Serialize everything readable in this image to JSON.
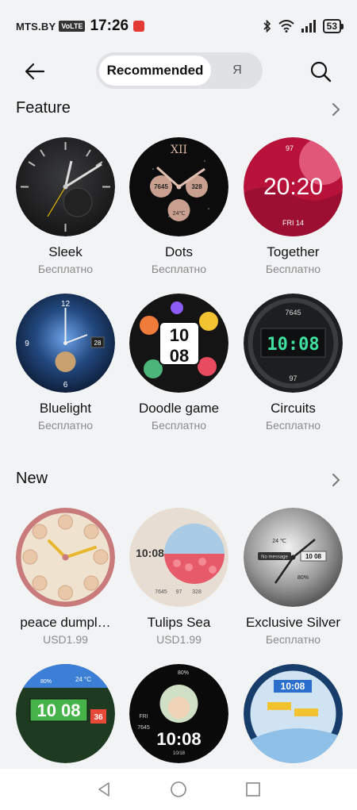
{
  "status": {
    "carrier": "MTS.BY",
    "volte": "VoLTE",
    "time": "17:26",
    "battery": "53"
  },
  "header": {
    "tab_active": "Recommended",
    "tab_other": "Я"
  },
  "sections": {
    "feature": {
      "title": "Feature",
      "items": [
        {
          "name": "Sleek",
          "price": "Бесплатно"
        },
        {
          "name": "Dots",
          "price": "Бесплатно"
        },
        {
          "name": "Together",
          "price": "Бесплатно"
        },
        {
          "name": "Bluelight",
          "price": "Бесплатно"
        },
        {
          "name": "Doodle game",
          "price": "Бесплатно"
        },
        {
          "name": "Circuits",
          "price": "Бесплатно"
        }
      ]
    },
    "new": {
      "title": "New",
      "items": [
        {
          "name": "peace dumpl…",
          "price": "USD1.99"
        },
        {
          "name": "Tulips Sea",
          "price": "USD1.99"
        },
        {
          "name": "Exclusive Silver",
          "price": "Бесплатно"
        }
      ]
    }
  },
  "dial_text": {
    "dots_left": "7645",
    "dots_right": "328",
    "dots_bottom": "24℃",
    "together_hr": "97",
    "together_time": "20:20",
    "together_date": "FRI 14",
    "bluelight_date": "28",
    "doodle_top": "10",
    "doodle_bottom": "08",
    "circuits_top": "7645",
    "circuits_time": "10:08",
    "circuits_bottom": "97",
    "tulips_time": "10:08",
    "tulips_steps": "7645",
    "tulips_a": "97",
    "tulips_b": "328",
    "silver_time": "10 08",
    "silver_msg": "No message",
    "silver_temp": "24 ℃",
    "silver_pct": "80%",
    "row4_a_time": "10 08",
    "row4_a_pct": "80%",
    "row4_a_temp": "24 °C",
    "row4_a_date": "36",
    "row4_b_pct": "80%",
    "row4_b_time": "10:08",
    "row4_b_date": "10/18",
    "row4_b_steps": "7645",
    "row4_b_day": "FRI",
    "row4_c_time": "10:08"
  }
}
